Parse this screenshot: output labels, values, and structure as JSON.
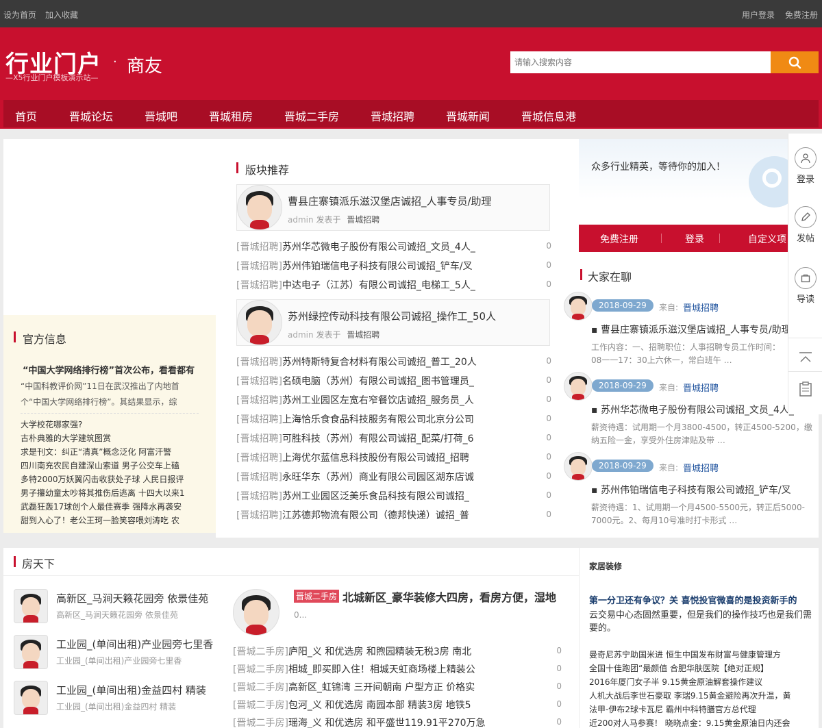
{
  "topbar": {
    "set_home": "设为首页",
    "add_fav": "加入收藏",
    "login": "用户登录",
    "register": "免费注册"
  },
  "header": {
    "logo": "行业门户",
    "logo_sub": "—X5行业门户模板演示站—",
    "dot": "·",
    "site": "商友",
    "search_placeholder": "请输入搜索内容"
  },
  "nav": [
    "首页",
    "晋城论坛",
    "晋城吧",
    "晋城租房",
    "晋城二手房",
    "晋城招聘",
    "晋城新闻",
    "晋城信息港"
  ],
  "official": {
    "title": "官方信息",
    "headline": "“中国大学网络排行榜”首次公布，看看都有",
    "summary": "“中国科教评价网”11日在武汉推出了内地首个“中国大学网络排行榜”。其结果显示，综",
    "items": [
      "大学校花哪家强?",
      "古朴典雅的大学建筑图赏",
      "求是刊文：纠正“清真”概念泛化  阿富汗警",
      "四川南充农民自建深山索道 男子公交车上磕",
      "多特2000万妖翼闪击收获处子球 人民日报评",
      "男子攥幼童太吵将其推伤后逃离 十四大以来1",
      "武磊狂轰17球创个人最佳赛季 强降水再袭安",
      "甜到入心了！老公王珂一脸笑容喂刘涛吃 农"
    ]
  },
  "recommend": {
    "title": "版块推荐",
    "feat1": {
      "title": "曹县庄寨镇派乐滋汉堡店诚招_人事专员/助理",
      "author": "admin",
      "posted": "发表于",
      "cat": "晋城招聘"
    },
    "list1": [
      {
        "cat": "[晋城招聘]",
        "title": "苏州华芯微电子股份有限公司诚招_文员_4人_",
        "num": "0"
      },
      {
        "cat": "[晋城招聘]",
        "title": "苏州伟铂瑞信电子科技有限公司诚招_铲车/叉",
        "num": "0"
      },
      {
        "cat": "[晋城招聘]",
        "title": "中达电子（江苏）有限公司诚招_电梯工_5人_",
        "num": "0"
      }
    ],
    "feat2": {
      "title": "苏州绿控传动科技有限公司诚招_操作工_50人",
      "author": "admin",
      "posted": "发表于",
      "cat": "晋城招聘"
    },
    "list2": [
      {
        "cat": "[晋城招聘]",
        "title": "苏州特斯特复合材料有限公司诚招_普工_20人",
        "num": "0"
      },
      {
        "cat": "[晋城招聘]",
        "title": "名硕电脑（苏州）有限公司诚招_图书管理员_",
        "num": "0"
      },
      {
        "cat": "[晋城招聘]",
        "title": "苏州工业园区左宽右窄餐饮店诚招_服务员_人",
        "num": "0"
      },
      {
        "cat": "[晋城招聘]",
        "title": "上海恰乐食食品科技服务有限公司北京分公司",
        "num": "0"
      },
      {
        "cat": "[晋城招聘]",
        "title": "可胜科技（苏州）有限公司诚招_配菜/打荷_6",
        "num": "0"
      },
      {
        "cat": "[晋城招聘]",
        "title": "上海优尔蓝信息科技股份有限公司诚招_招聘",
        "num": "0"
      },
      {
        "cat": "[晋城招聘]",
        "title": "永旺华东（苏州）商业有限公司园区湖东店诚",
        "num": "0"
      },
      {
        "cat": "[晋城招聘]",
        "title": "苏州工业园区泛美乐食品科技有限公司诚招_",
        "num": "0"
      },
      {
        "cat": "[晋城招聘]",
        "title": "江苏德邦物流有限公司（德邦快递）诚招_普",
        "num": "0"
      }
    ]
  },
  "right": {
    "welcome": "众多行业精英，等待你的加入！",
    "bar": [
      "免费注册",
      "登录",
      "自定义项"
    ],
    "chat_title": "大家在聊",
    "from": "来自:",
    "chats": [
      {
        "date": "2018-09-29",
        "cat": "晋城招聘",
        "title": "曹县庄寨镇派乐滋汉堡店诚招_人事专员/助理",
        "desc": "工作内容：一、招聘职位：人事招聘专员工作时间：08一一17：30上六休一，常白班午 …"
      },
      {
        "date": "2018-09-29",
        "cat": "晋城招聘",
        "title": "苏州华芯微电子股份有限公司诚招_文员_4人_",
        "desc": "薪资待遇：试用期一个月3800-4500，转正4500-5200，缴纳五险一金，享受外住房津贴及带 …"
      },
      {
        "date": "2018-09-29",
        "cat": "晋城招聘",
        "title": "苏州伟铂瑞信电子科技有限公司诚招_铲车/叉",
        "desc": "薪资待遇：1、试用期一个月4500-5500元，转正后5000-7000元。2、每月10号准时打卡形式 …"
      }
    ]
  },
  "side_tools": {
    "login": "登录",
    "post": "发帖",
    "guide": "导读"
  },
  "house": {
    "title": "房天下",
    "items": [
      {
        "title": "高新区_马涧天籁花园旁 依景佳苑",
        "sub": "高新区_马涧天籁花园旁 依景佳苑"
      },
      {
        "title": "工业园_(单间出租)产业园旁七里香",
        "sub": "工业园_(单间出租)产业园旁七里香"
      },
      {
        "title": "工业园_(单间出租)金益四村 精装",
        "sub": "工业园_(单间出租)金益四村 精装"
      }
    ],
    "feat": {
      "tag": "晋城二手房",
      "title": "北城新区_豪华装修大四房，看房方便，湿地",
      "desc": "0..."
    },
    "list": [
      {
        "cat": "[晋城二手房]",
        "title": "庐阳_义 和优选房 和煦园精装无税3房 南北",
        "num": "0"
      },
      {
        "cat": "[晋城二手房]",
        "title": "相城_即买即入住！相城天虹商场楼上精装公",
        "num": "0"
      },
      {
        "cat": "[晋城二手房]",
        "title": "高新区_虹锦湾 三开间朝南 户型方正 价格实",
        "num": "0"
      },
      {
        "cat": "[晋城二手房]",
        "title": "包河_义 和优选房 南园本部 精装3房 地铁5",
        "num": "0"
      },
      {
        "cat": "[晋城二手房]",
        "title": "瑶海_义 和优选房 和平盛世119.91平270万急",
        "num": "0"
      }
    ]
  },
  "decor": {
    "title": "家居装修",
    "headline": "第一分卫还有争议？关 喜悦投官微喜的是投资新手的",
    "summary": "云交易中心态固然重要，但是我们的操作技巧也是我们需要的。",
    "items": [
      "曼奇尼苏宁助国米进 恒生中国发布财富与健康管理方",
      "全国十佳跑团“最颜值 合肥华肤医院【绝对正规】",
      "2016年厦门女子半 9.15黄金原油解套操作建议",
      "人机大战后李世石豪取 李瑞9.15黄金避险再次升温，黄",
      "法甲-伊布2球卡瓦尼 霸州中科特膳官方总代理",
      "近200对人马参赛！ 晓晓点金：9.15黄金原油日内还会"
    ]
  },
  "colors": {
    "brand": "#c8102e",
    "nav": "#a80d25",
    "accent": "#f08a14",
    "pill": "#7ea8cf"
  }
}
